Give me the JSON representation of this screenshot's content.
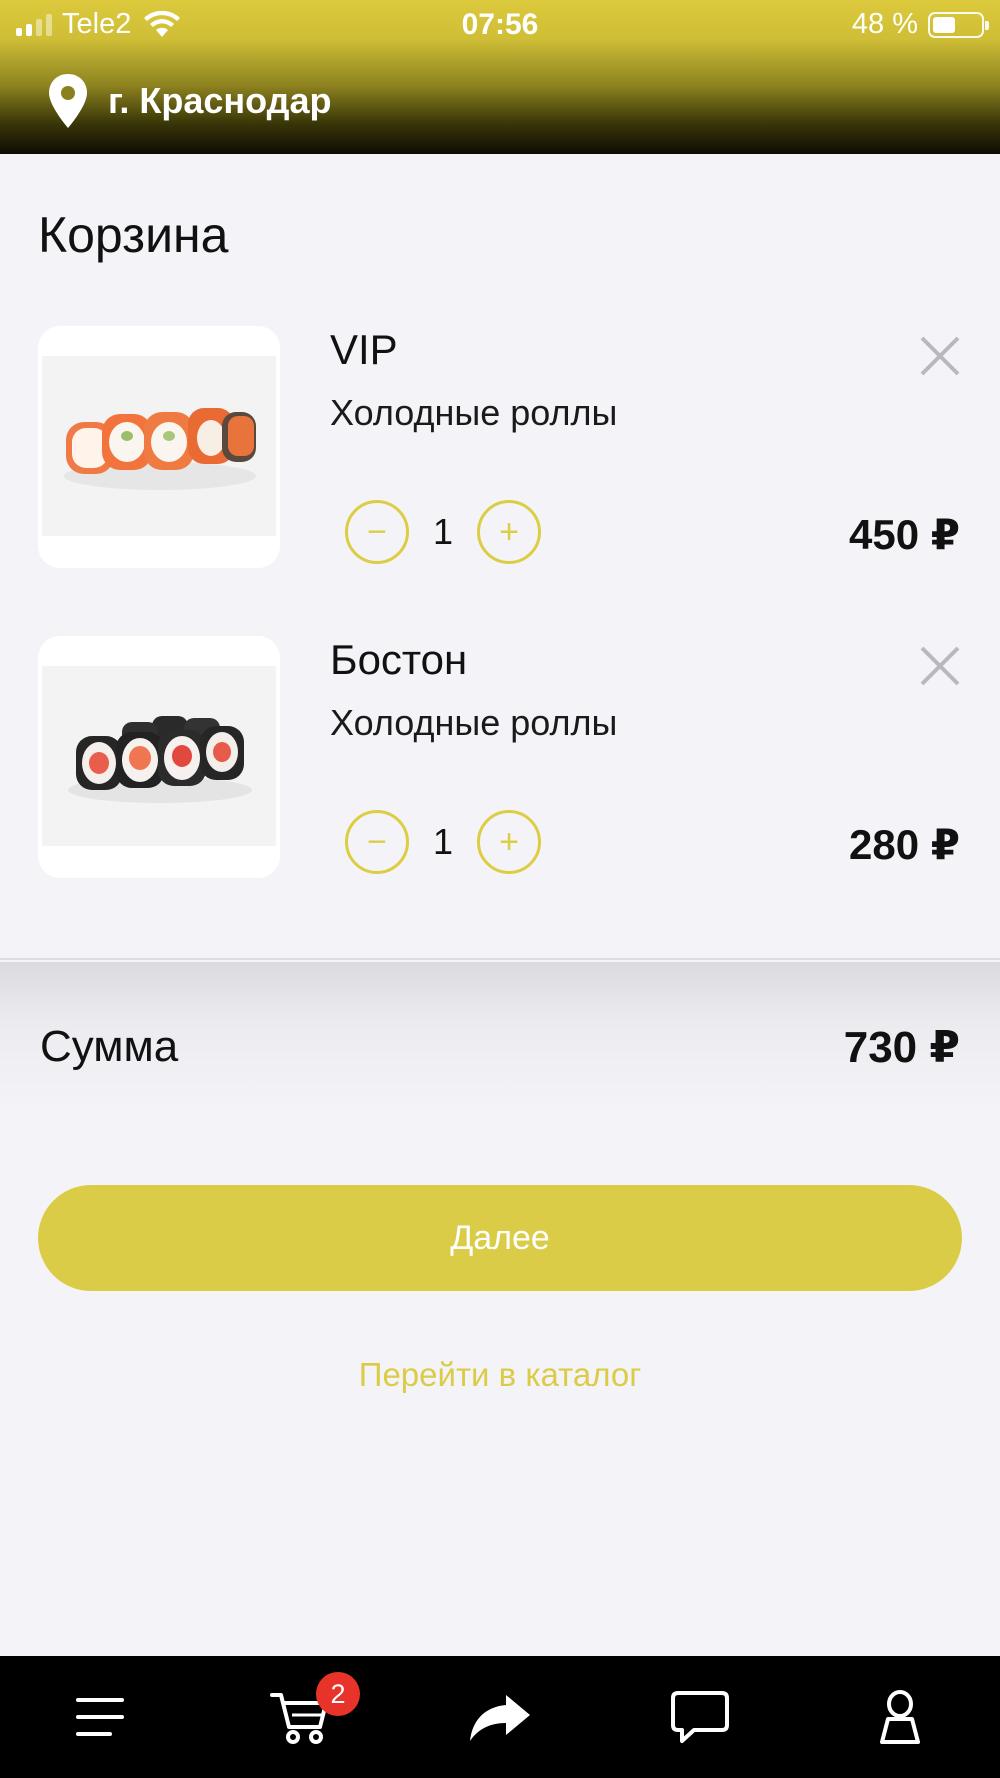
{
  "status_bar": {
    "carrier": "Tele2",
    "time": "07:56",
    "battery_text": "48 %",
    "battery_level": 0.48
  },
  "header": {
    "city": "г. Краснодар",
    "icon": "map-pin-icon"
  },
  "cart": {
    "title": "Корзина",
    "items": [
      {
        "name": "VIP",
        "category": "Холодные роллы",
        "quantity": "1",
        "price": "450 ₽",
        "minus": "−",
        "plus": "+"
      },
      {
        "name": "Бостон",
        "category": "Холодные роллы",
        "quantity": "1",
        "price": "280 ₽",
        "minus": "−",
        "plus": "+"
      }
    ]
  },
  "summary": {
    "label": "Сумма",
    "value": "730 ₽"
  },
  "actions": {
    "next_label": "Далее",
    "catalog_link": "Перейти в каталог"
  },
  "bottom_nav": {
    "cart_badge": "2",
    "items": [
      "menu-icon",
      "cart-icon",
      "share-icon",
      "chat-icon",
      "profile-icon"
    ]
  },
  "colors": {
    "accent": "#dbcc48",
    "badge": "#e8332b",
    "nav_background": "#000000"
  }
}
